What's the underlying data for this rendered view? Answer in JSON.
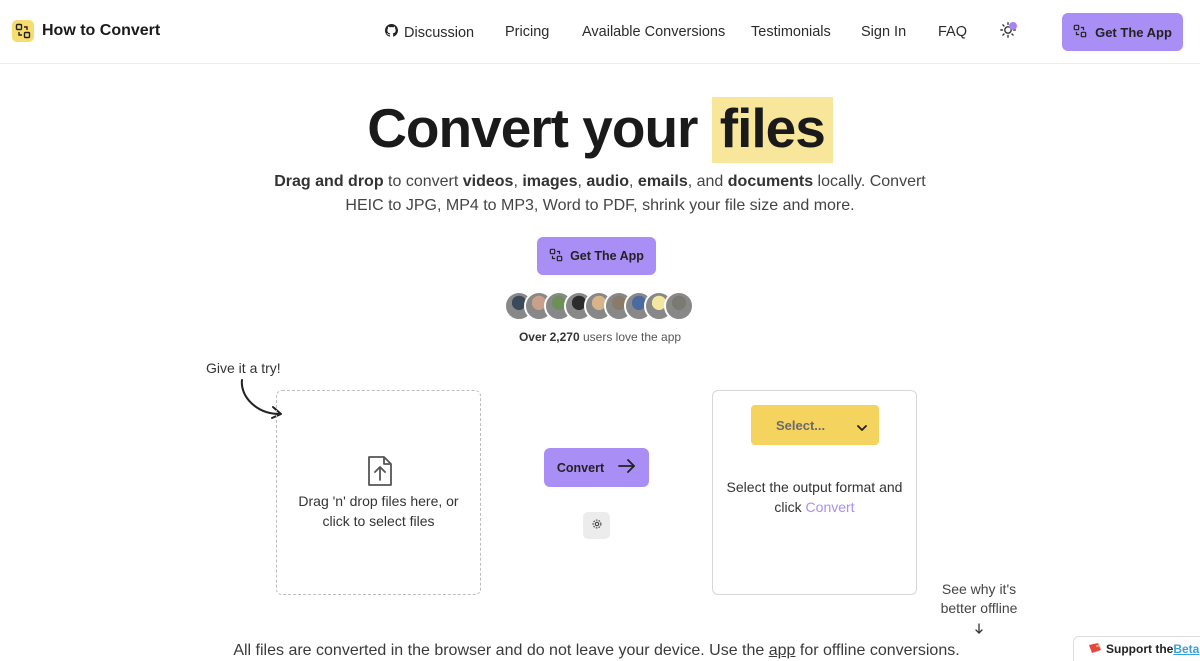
{
  "header": {
    "brand": "How to Convert",
    "nav": {
      "discussion": "Discussion",
      "pricing": "Pricing",
      "available_conversions": "Available Conversions",
      "testimonials": "Testimonials",
      "sign_in": "Sign In",
      "faq": "FAQ"
    },
    "theme_icon": "sun-icon",
    "cta_label": "Get The App"
  },
  "hero": {
    "title_main": "Convert your",
    "title_highlight": "files",
    "subtitle": {
      "drag_and_drop": "Drag and drop",
      "to_convert": " to convert ",
      "videos": "videos",
      "sep1": ", ",
      "images": "images",
      "sep2": ", ",
      "audio": "audio",
      "sep3": ", ",
      "emails": "emails",
      "and": ", and ",
      "documents": "documents",
      "rest": " locally. Convert HEIC to JPG, MP4 to MP3, Word to PDF, shrink your file size and more."
    },
    "cta_label": "Get The App",
    "users_count": "Over 2,270",
    "users_suffix": " users love the app"
  },
  "converter": {
    "try_label": "Give it a try!",
    "dropzone_line1": "Drag 'n' drop files here, or",
    "dropzone_line2": "click to select files",
    "convert_label": "Convert",
    "settings_icon": "gear-icon",
    "select_placeholder": "Select...",
    "output_hint_line1": "Select the output format and",
    "output_hint_click": "click ",
    "output_hint_link": "Convert"
  },
  "offline_note": {
    "line1": "See why it's",
    "line2": "better offline"
  },
  "footer": {
    "before": "All files are converted in the browser and do not leave your device. Use the ",
    "app_link": "app",
    "after": " for offline conversions."
  },
  "beta_badge": {
    "prefix": "Support the ",
    "link": "Beta"
  },
  "colors": {
    "accent": "#a98ff5",
    "highlight": "#f8e79a",
    "select": "#f4d35e",
    "link": "#a98ff5"
  },
  "avatars": [
    "#3b4a5a",
    "#c9a08a",
    "#6f8f5a",
    "#2c2c2c",
    "#d8b48a",
    "#8a7a6a",
    "#4a6aa0",
    "#f2e6a0",
    "#7a7a72"
  ]
}
